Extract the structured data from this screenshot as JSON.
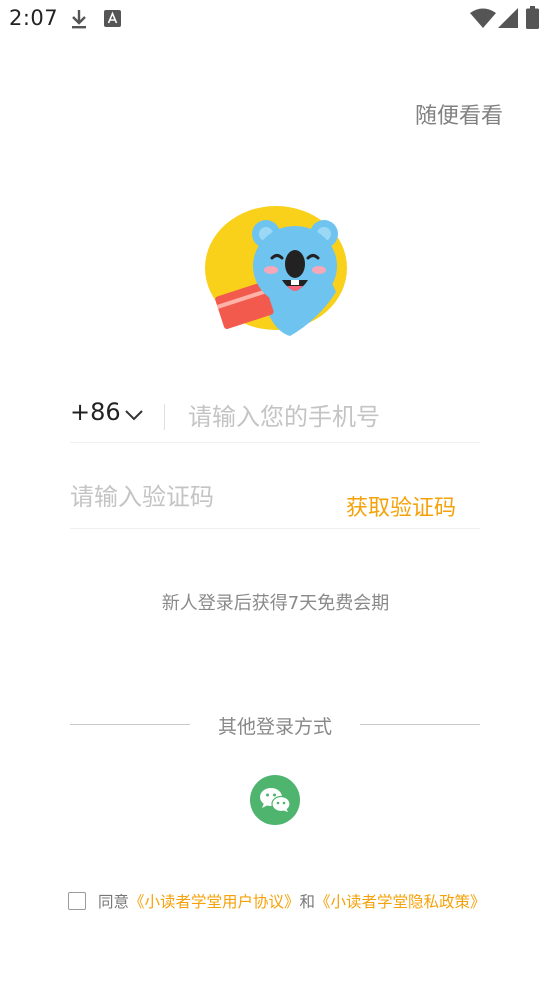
{
  "status_bar": {
    "time": "2:07",
    "icons": [
      "download-icon",
      "keyboard-a-icon",
      "wifi-icon",
      "signal-icon",
      "battery-icon"
    ]
  },
  "header": {
    "skip_label": "随便看看"
  },
  "mascot": {
    "icon": "koala-mascot-logo",
    "bubble_color": "#f9d01a",
    "body_color": "#6ec3ef",
    "book_color": "#f25a4e"
  },
  "phone": {
    "country_code": "+86",
    "placeholder": "请输入您的手机号",
    "value": ""
  },
  "code": {
    "placeholder": "请输入验证码",
    "value": "",
    "get_code_label": "获取验证码"
  },
  "promo_text": "新人登录后获得7天免费会期",
  "other_login": {
    "label": "其他登录方式",
    "wechat_icon": "wechat-icon"
  },
  "agreement": {
    "checked": false,
    "prefix": "同意",
    "user_agreement": "《小读者学堂用户协议》",
    "conjunction": "和",
    "privacy_policy": "《小读者学堂隐私政策》"
  },
  "colors": {
    "accent": "#f5a20a",
    "wechat": "#4fb46d",
    "placeholder": "#c4c4c4"
  }
}
